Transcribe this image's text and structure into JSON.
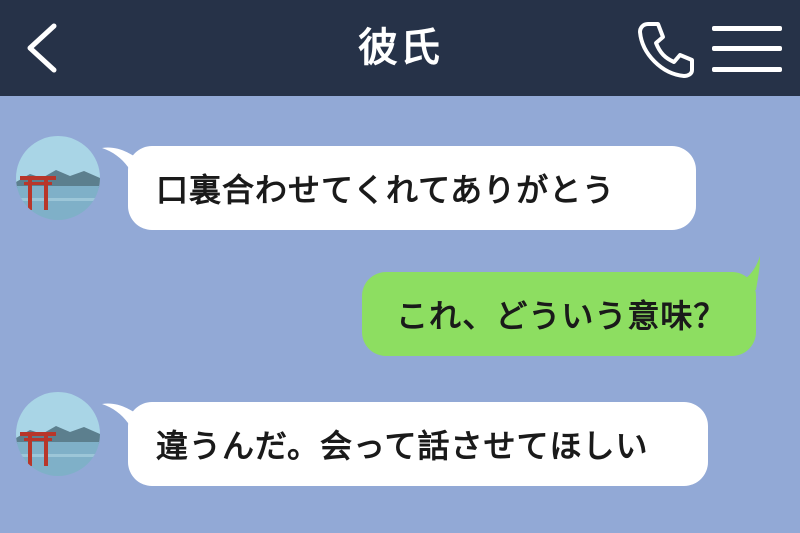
{
  "header": {
    "title": "彼氏",
    "back_icon": "chevron-left-icon",
    "call_icon": "phone-icon",
    "menu_icon": "hamburger-menu-icon"
  },
  "messages": [
    {
      "side": "received",
      "text": "口裏合わせてくれてありがとう"
    },
    {
      "side": "sent",
      "text": "これ、どういう意味？"
    },
    {
      "side": "received",
      "text": "違うんだ。会って話させてほしい"
    }
  ],
  "colors": {
    "header_bg": "#263248",
    "chat_bg": "#92a9d6",
    "received_bubble": "#ffffff",
    "sent_bubble": "#8dde61"
  }
}
